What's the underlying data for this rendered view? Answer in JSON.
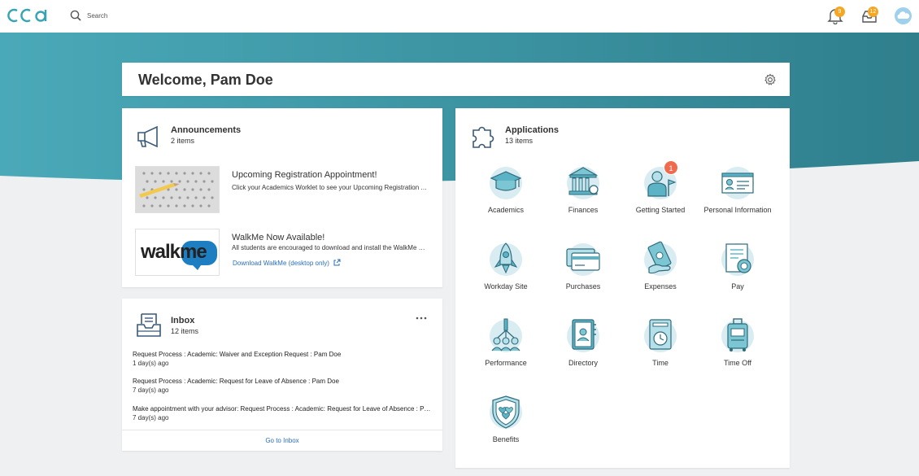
{
  "brand": {
    "logo_text": "CCA"
  },
  "search": {
    "placeholder": "Search"
  },
  "header": {
    "notifications_count": "9",
    "inbox_count": "12"
  },
  "welcome": {
    "title": "Welcome, Pam Doe"
  },
  "announcements": {
    "title": "Announcements",
    "count": "2 items",
    "items": [
      {
        "title": "Upcoming Registration Appointment!",
        "description": "Click your Academics Worklet to see your Upcoming Registration Appointment"
      },
      {
        "title": "WalkMe Now Available!",
        "description": "All students are encouraged to download and install the WalkMe browser extension",
        "link": "Download WalkMe (desktop only)",
        "logo_text": "walkme"
      }
    ]
  },
  "inbox": {
    "title": "Inbox",
    "count": "12 items",
    "items": [
      {
        "title": "Request Process : Academic: Waiver and Exception Request : Pam Doe",
        "time": "1 day(s) ago"
      },
      {
        "title": "Request Process : Academic: Request for Leave of Absence : Pam Doe",
        "time": "7 day(s) ago"
      },
      {
        "title": "Make appointment with your advisor: Request Process : Academic: Request for Leave of Absence : Pam Doe",
        "time": "7 day(s) ago"
      }
    ],
    "footer_link": "Go to Inbox"
  },
  "applications": {
    "title": "Applications",
    "count": "13 items",
    "items": [
      {
        "label": "Academics",
        "icon": "graduation-cap-icon"
      },
      {
        "label": "Finances",
        "icon": "bank-building-icon"
      },
      {
        "label": "Getting Started",
        "icon": "person-flag-icon",
        "badge": "1"
      },
      {
        "label": "Personal Information",
        "icon": "id-card-icon"
      },
      {
        "label": "Workday Site",
        "icon": "rocket-icon"
      },
      {
        "label": "Purchases",
        "icon": "credit-card-icon"
      },
      {
        "label": "Expenses",
        "icon": "money-hand-icon"
      },
      {
        "label": "Pay",
        "icon": "pay-document-icon"
      },
      {
        "label": "Performance",
        "icon": "team-chart-icon"
      },
      {
        "label": "Directory",
        "icon": "directory-book-icon"
      },
      {
        "label": "Time",
        "icon": "time-clock-icon"
      },
      {
        "label": "Time Off",
        "icon": "luggage-icon"
      },
      {
        "label": "Benefits",
        "icon": "shield-hearts-icon"
      }
    ]
  },
  "colors": {
    "accent": "#2a6ebb",
    "hero_teal": "#3f98a8",
    "badge_orange": "#f5a623",
    "badge_red": "#f06b4e"
  }
}
